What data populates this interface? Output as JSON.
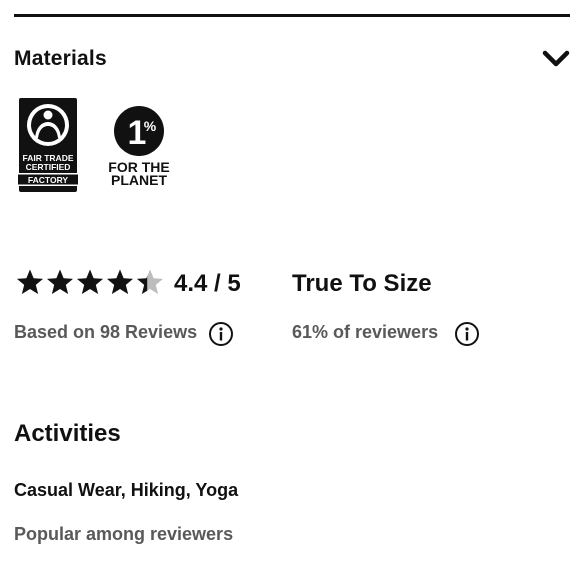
{
  "materials": {
    "title": "Materials",
    "toggle_icon": "chevron-down-icon",
    "badges": [
      {
        "icon": "fair-trade-certified-logo",
        "text_lines": [
          "FAIR TRADE",
          "CERTIFIED",
          "FACTORY"
        ]
      },
      {
        "icon": "one-percent-for-the-planet-logo",
        "text_lines": [
          "1",
          "%",
          "FOR THE",
          "PLANET"
        ]
      }
    ]
  },
  "rating": {
    "value": 4.4,
    "max": 5,
    "display": "4.4 / 5",
    "reviews_text": "Based on 98 Reviews",
    "info_icon": "info-icon",
    "star_color": "#111111",
    "star_empty_color": "#bdbdbd"
  },
  "fit": {
    "title": "True To Size",
    "reviewers_text": "61% of reviewers",
    "info_icon": "info-icon"
  },
  "activities": {
    "title": "Activities",
    "list": "Casual Wear, Hiking, Yoga",
    "note": "Popular among reviewers"
  }
}
